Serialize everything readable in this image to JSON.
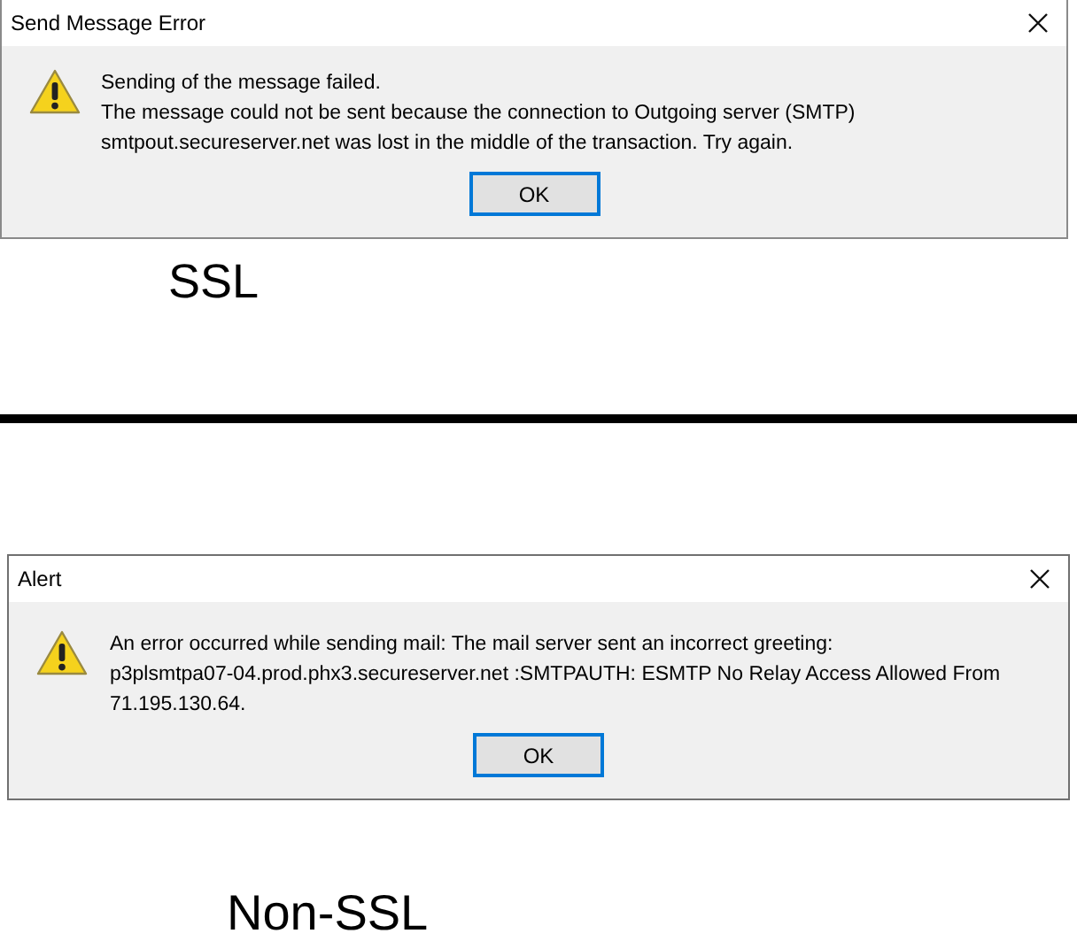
{
  "dialogs": [
    {
      "title": "Send Message Error",
      "lines": [
        "Sending of the message failed.",
        "The message could not be sent because the connection to Outgoing server (SMTP)",
        "smtpout.secureserver.net was lost in the middle of the transaction. Try again."
      ],
      "button": "OK",
      "caption": "SSL"
    },
    {
      "title": "Alert",
      "lines": [
        "An error occurred while sending mail: The mail server sent an incorrect greeting:",
        "p3plsmtpa07-04.prod.phx3.secureserver.net :SMTPAUTH: ESMTP No Relay Access Allowed From",
        "71.195.130.64."
      ],
      "button": "OK",
      "caption": "Non-SSL"
    }
  ]
}
